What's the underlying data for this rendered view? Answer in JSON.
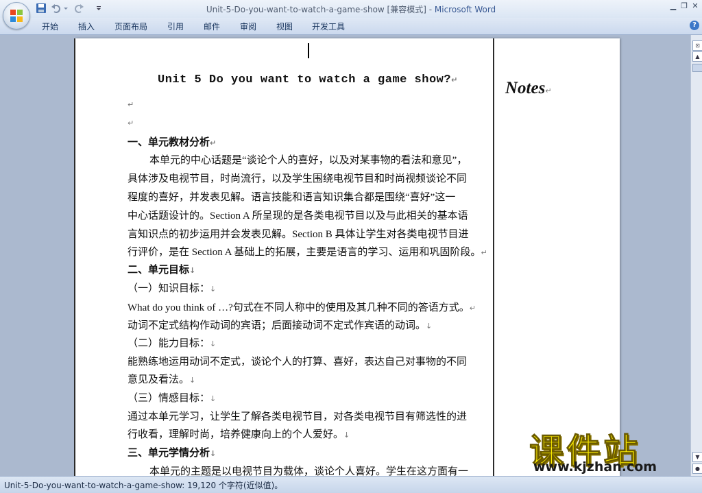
{
  "window": {
    "title": "Unit-5-Do-you-want-to-watch-a-game-show [兼容模式] - ",
    "app_name": "Microsoft Word"
  },
  "quick_access": [
    "save-icon",
    "undo-icon",
    "redo-icon",
    "customize-icon"
  ],
  "ribbon": {
    "tabs": [
      "开始",
      "插入",
      "页面布局",
      "引用",
      "邮件",
      "审阅",
      "视图",
      "开发工具"
    ]
  },
  "document": {
    "title": "Unit 5 Do you want to watch a game show?",
    "section1_heading": "一、单元教材分析",
    "section1_lines": [
      "本单元的中心话题是“谈论个人的喜好，以及对某事物的看法和意见”，",
      "具体涉及电视节目，时尚流行，以及学生围绕电视节目和时尚视频谈论不同",
      "程度的喜好，并发表见解。语言技能和语言知识集合都是围绕“喜好”这一",
      "中心话题设计的。Section A  所呈现的是各类电视节目以及与此相关的基本语",
      "言知识点的初步运用并会发表见解。Section B  具体让学生对各类电视节目进",
      "行评价，是在 Section A 基础上的拓展，主要是语言的学习、运用和巩固阶段。"
    ],
    "section2_heading": "二、单元目标",
    "knowledge_heading": "（一）知识目标：",
    "knowledge_lines": [
      "What do you think of  …?句式在不同人称中的使用及其几种不同的答语方式。",
      "动词不定式结构作动词的宾语；后面接动词不定式作宾语的动词。"
    ],
    "ability_heading": "（二）能力目标：",
    "ability_lines": [
      "能熟练地运用动词不定式，谈论个人的打算、喜好，表达自己对事物的不同",
      "意见及看法。"
    ],
    "emotion_heading": "（三）情感目标：",
    "emotion_lines": [
      "通过本单元学习，让学生了解各类电视节目，对各类电视节目有筛选性的进",
      "行收看，理解时尚，培养健康向上的个人爱好。"
    ],
    "section3_heading": "三、单元学情分析",
    "section3_lines": [
      "本单元的主题是以电视节目为载体，谈论个人喜好。学生在这方面有一"
    ],
    "notes_label": "Notes"
  },
  "status_bar": {
    "text": "Unit-5-Do-you-want-to-watch-a-game-show: 19,120 个字符(近似值)。"
  },
  "watermark": {
    "cn": "课件站",
    "url": "www.kjzhan.com"
  },
  "colors": {
    "title_app": "#3a5a94",
    "workspace": "#abb9cf",
    "watermark_yellow": "#ffee00"
  }
}
